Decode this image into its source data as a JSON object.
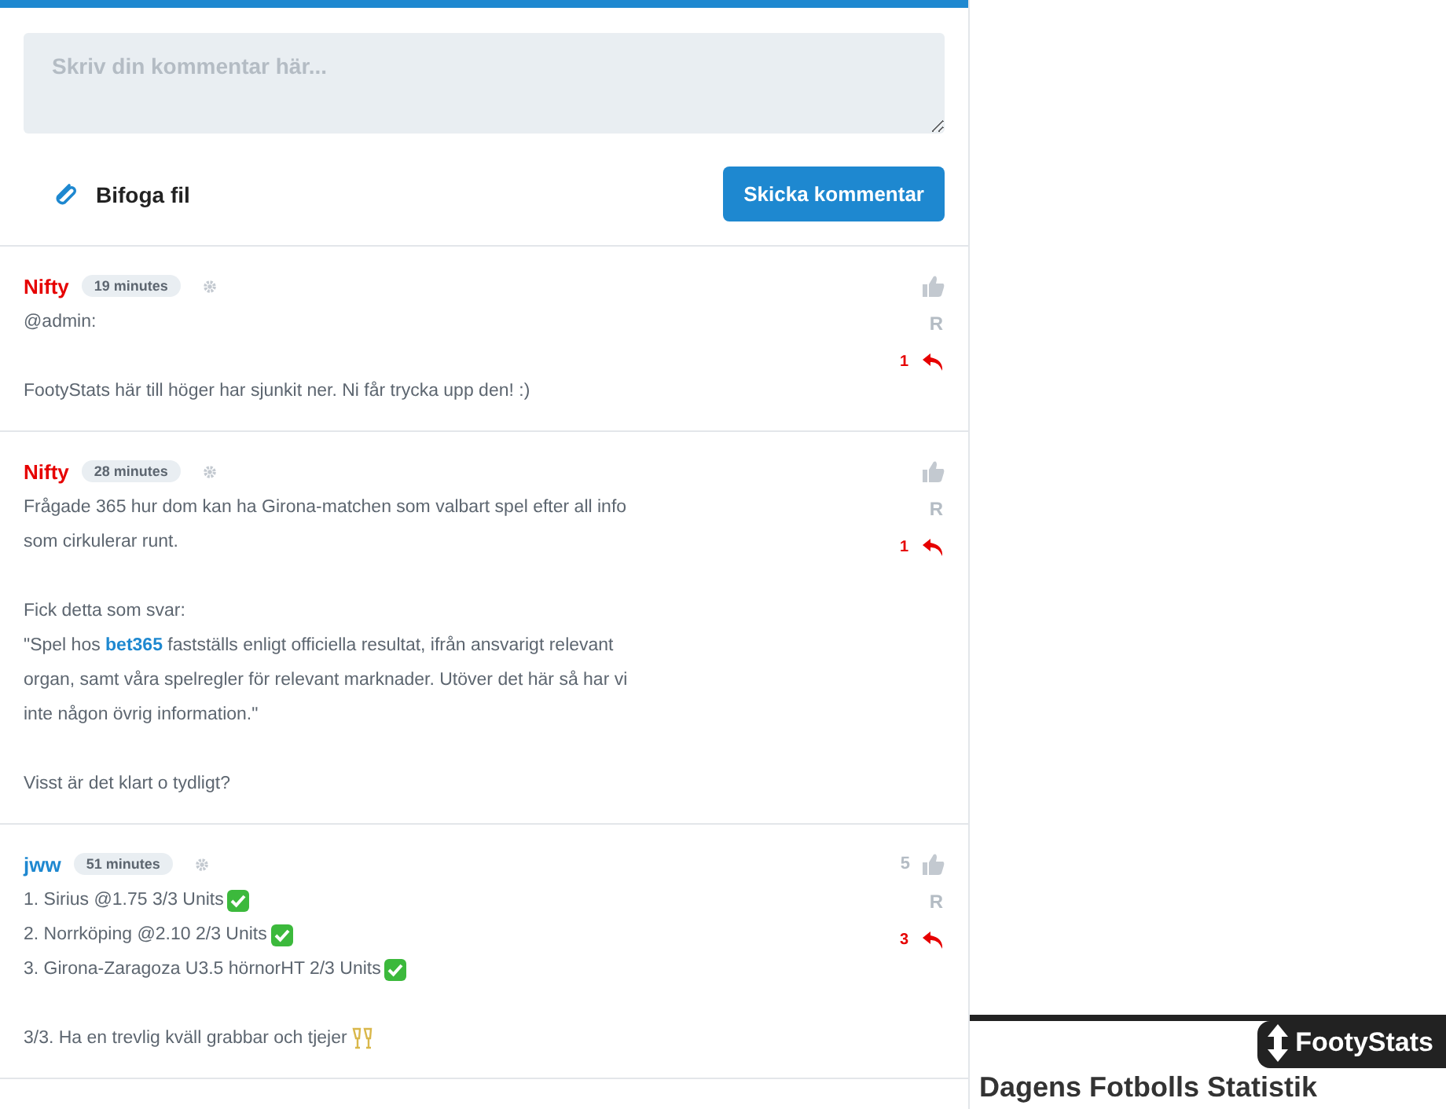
{
  "comment_form": {
    "placeholder": "Skriv din kommentar här...",
    "attach_label": "Bifoga fil",
    "submit_label": "Skicka kommentar"
  },
  "comments": [
    {
      "author": "Nifty",
      "color": "#e60000",
      "time": "19 minutes",
      "reply_count": "1",
      "report": "R",
      "body": [
        {
          "kind": "text",
          "segments": [
            {
              "text": "@admin:"
            }
          ]
        },
        {
          "kind": "spacer"
        },
        {
          "kind": "text",
          "segments": [
            {
              "text": "FootyStats här till höger har sjunkit ner. Ni får trycka upp den! :)"
            }
          ]
        }
      ]
    },
    {
      "author": "Nifty",
      "color": "#e60000",
      "time": "28 minutes",
      "reply_count": "1",
      "report": "R",
      "body": [
        {
          "kind": "text",
          "segments": [
            {
              "text": "Frågade 365 hur dom kan ha Girona-matchen som valbart spel efter all info som cirkulerar runt."
            }
          ]
        },
        {
          "kind": "spacer"
        },
        {
          "kind": "text",
          "segments": [
            {
              "text": "Fick detta som svar:"
            }
          ]
        },
        {
          "kind": "text",
          "segments": [
            {
              "text": "\"Spel hos ",
              "link": false
            },
            {
              "text": "bet365",
              "link": true
            },
            {
              "text": " fastställs enligt officiella resultat, ifrån ansvarigt relevant organ, samt våra spelregler för relevant marknader. Utöver det här så har vi inte någon övrig information.\"",
              "link": false
            }
          ]
        },
        {
          "kind": "spacer"
        },
        {
          "kind": "text",
          "segments": [
            {
              "text": "Visst är det klart o tydligt?"
            }
          ]
        }
      ]
    },
    {
      "author": "jww",
      "color": "#1e88d0",
      "time": "51 minutes",
      "likes": "5",
      "reply_count": "3",
      "report": "R",
      "body": [
        {
          "kind": "check",
          "segments": [
            {
              "text": "1. Sirius @1.75 3/3 Units"
            }
          ]
        },
        {
          "kind": "check",
          "segments": [
            {
              "text": "2. Norrköping @2.10 2/3 Units"
            }
          ]
        },
        {
          "kind": "check",
          "segments": [
            {
              "text": "3. Girona-Zaragoza U3.5 hörnorHT 2/3 Units"
            }
          ]
        },
        {
          "kind": "spacer"
        },
        {
          "kind": "cheers",
          "segments": [
            {
              "text": "3/3. Ha en trevlig kväll grabbar och tjejer"
            }
          ]
        }
      ]
    }
  ],
  "sidebar": {
    "widget_brand": "FootyStats",
    "widget_heading": "Dagens Fotbolls Statistik"
  }
}
